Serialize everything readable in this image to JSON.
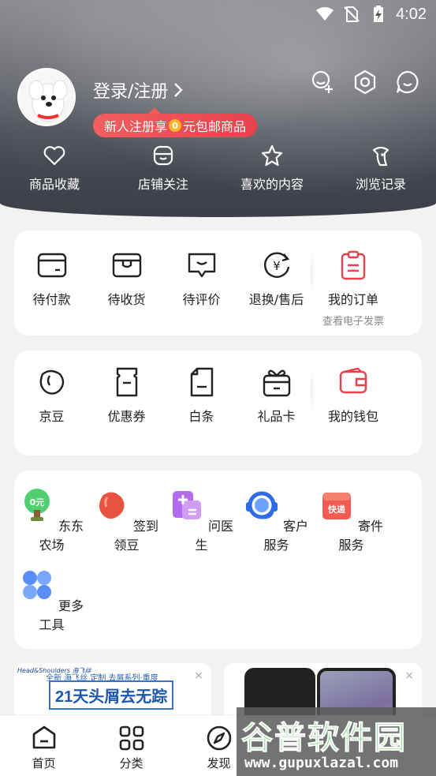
{
  "status_bar": {
    "time": "4:02"
  },
  "profile": {
    "login_label": "登录/注册",
    "promo_prefix": "新人注册享",
    "promo_coin": "0",
    "promo_suffix": "元包邮商品"
  },
  "header_actions": [
    "add-friend-icon",
    "settings-icon",
    "message-icon"
  ],
  "quick_links": [
    {
      "label": "商品收藏",
      "icon": "heart-icon"
    },
    {
      "label": "店铺关注",
      "icon": "shop-icon"
    },
    {
      "label": "喜欢的内容",
      "icon": "star-icon"
    },
    {
      "label": "浏览记录",
      "icon": "footprint-icon"
    }
  ],
  "orders": {
    "items": [
      {
        "label": "待付款",
        "icon": "wallet-icon"
      },
      {
        "label": "待收货",
        "icon": "box-icon"
      },
      {
        "label": "待评价",
        "icon": "comment-icon"
      },
      {
        "label": "退换/售后",
        "icon": "refund-icon"
      }
    ],
    "my_orders": {
      "label": "我的订单",
      "note": "查看电子发票"
    }
  },
  "assets": {
    "items": [
      {
        "label": "京豆",
        "icon": "bean-icon"
      },
      {
        "label": "优惠券",
        "icon": "coupon-icon"
      },
      {
        "label": "白条",
        "icon": "ious-icon"
      },
      {
        "label": "礼品卡",
        "icon": "gift-card-icon"
      }
    ],
    "wallet": {
      "label": "我的钱包"
    }
  },
  "tools": [
    {
      "label": "东东农场",
      "badge": "0元"
    },
    {
      "label": "签到领豆"
    },
    {
      "label": "问医生"
    },
    {
      "label": "客户服务"
    },
    {
      "label": "寄件服务",
      "badge": "快递"
    },
    {
      "label": "更多工具"
    }
  ],
  "ads": {
    "left": {
      "brand": "Head&Shoulders 海飞丝",
      "tagline": "全新 海飞丝 定制 去屑系列·重度",
      "headline": "21天头屑去无踪",
      "close": "×"
    },
    "right": {
      "close": "×"
    }
  },
  "tabbar": [
    {
      "label": "首页"
    },
    {
      "label": "分类"
    },
    {
      "label": "发现"
    }
  ],
  "watermark": {
    "title": "谷普软件园",
    "url": "www.gupuxlazal.com"
  },
  "colors": {
    "accent": "#e8414e",
    "promo": "#f05a5a"
  }
}
